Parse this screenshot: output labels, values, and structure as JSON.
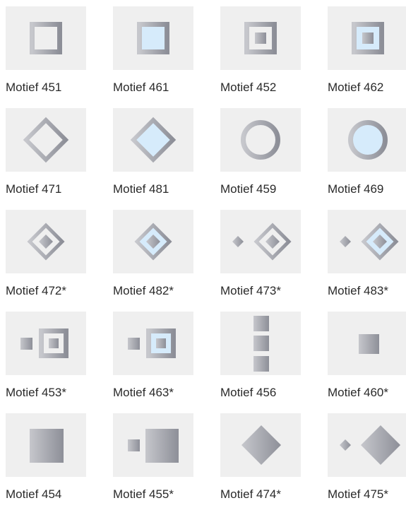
{
  "motifs": [
    {
      "label": "Motief 451",
      "icon": "hollow-square-icon"
    },
    {
      "label": "Motief 461",
      "icon": "filled-square-icon"
    },
    {
      "label": "Motief 452",
      "icon": "square-with-inner-square-icon"
    },
    {
      "label": "Motief 462",
      "icon": "filled-square-with-inner-square-icon"
    },
    {
      "label": "Motief 471",
      "icon": "hollow-diamond-icon"
    },
    {
      "label": "Motief 481",
      "icon": "filled-diamond-icon"
    },
    {
      "label": "Motief 459",
      "icon": "hollow-circle-icon"
    },
    {
      "label": "Motief 469",
      "icon": "filled-circle-icon"
    },
    {
      "label": "Motief 472*",
      "icon": "diamond-with-inner-diamond-icon"
    },
    {
      "label": "Motief 482*",
      "icon": "filled-diamond-with-inner-diamond-icon"
    },
    {
      "label": "Motief 473*",
      "icon": "small-diamond-and-diamond-frame-icon"
    },
    {
      "label": "Motief 483*",
      "icon": "small-diamond-and-filled-diamond-frame-icon"
    },
    {
      "label": "Motief 453*",
      "icon": "small-square-and-square-frame-icon"
    },
    {
      "label": "Motief 463*",
      "icon": "small-square-and-filled-square-frame-icon"
    },
    {
      "label": "Motief 456",
      "icon": "three-stacked-squares-icon"
    },
    {
      "label": "Motief 460*",
      "icon": "small-solid-square-icon"
    },
    {
      "label": "Motief 454",
      "icon": "large-solid-square-icon"
    },
    {
      "label": "Motief 455*",
      "icon": "small-and-large-solid-squares-icon"
    },
    {
      "label": "Motief 474*",
      "icon": "solid-diamond-icon"
    },
    {
      "label": "Motief 475*",
      "icon": "small-and-large-solid-diamonds-icon"
    }
  ],
  "colors": {
    "tile_background": "#efefef",
    "metal_light": "#c6c7cc",
    "metal_dark": "#8d8f98",
    "glass_fill": "#d6ebfb"
  }
}
